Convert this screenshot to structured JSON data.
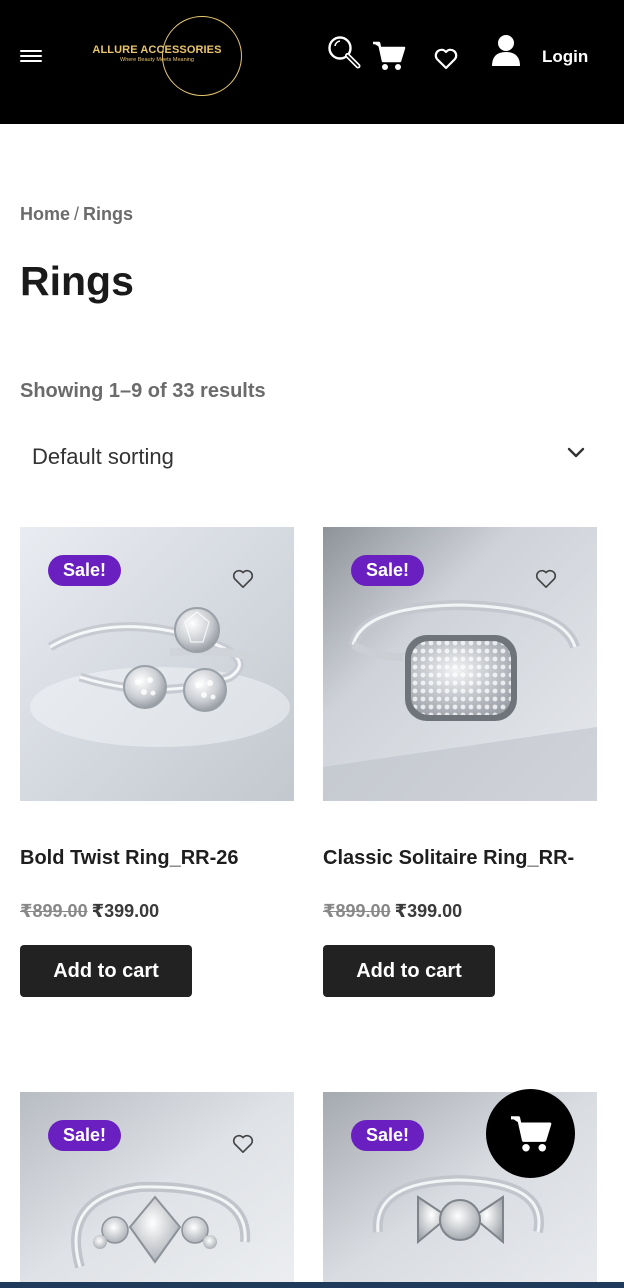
{
  "header": {
    "logo_name": "ALLURE ACCESSORIES",
    "logo_tagline": "Where Beauty Meets Meaning",
    "login_label": "Login",
    "icons": [
      "menu-icon",
      "search-icon",
      "cart-icon",
      "heart-icon",
      "user-icon"
    ]
  },
  "breadcrumb": {
    "home": "Home",
    "separator": "/",
    "current": "Rings"
  },
  "page_title": "Rings",
  "result_count": "Showing 1–9 of 33 results",
  "sorting": {
    "selected": "Default sorting"
  },
  "products": [
    {
      "badge": "Sale!",
      "title": "Bold Twist Ring_RR-26",
      "old_price": "₹899.00",
      "price": "₹399.00",
      "button": "Add to cart"
    },
    {
      "badge": "Sale!",
      "title": "Classic Solitaire Ring_RR-",
      "old_price": "₹899.00",
      "price": "₹399.00",
      "button": "Add to cart"
    },
    {
      "badge": "Sale!"
    },
    {
      "badge": "Sale!"
    }
  ],
  "colors": {
    "header_bg": "#000000",
    "logo_gold": "#e9c46a",
    "sale_badge": "#6a1fc1",
    "button": "#222222"
  }
}
